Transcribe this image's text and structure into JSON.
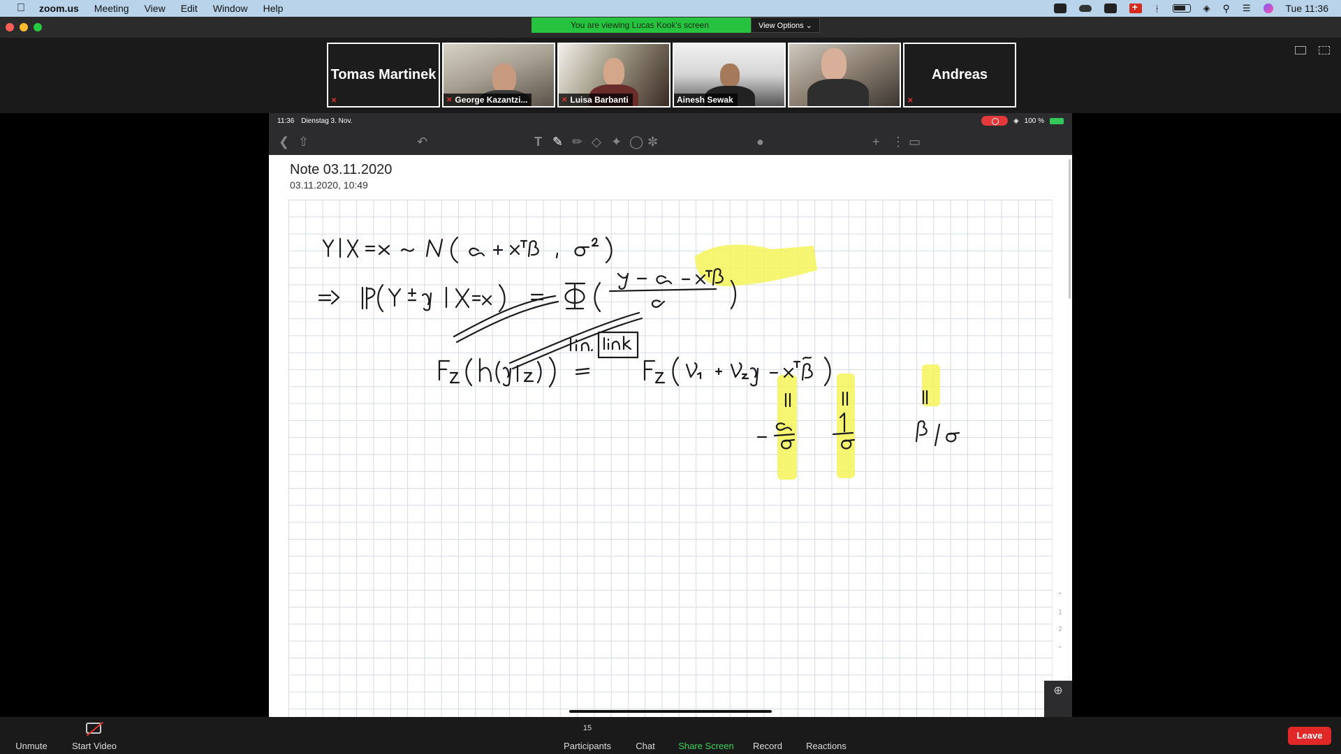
{
  "menubar": {
    "app_name": "zoom.us",
    "items": [
      "Meeting",
      "View",
      "Edit",
      "Window",
      "Help"
    ],
    "clock": "Tue 11:36"
  },
  "banner": {
    "message": "You are viewing Lucas Kook's screen",
    "options_label": "View Options"
  },
  "participants_strip": [
    {
      "name": "Tomas Martinek",
      "video": false,
      "muted": true
    },
    {
      "name": "George Kazantzi...",
      "video": true,
      "muted": true
    },
    {
      "name": "Luisa Barbanti",
      "video": true,
      "muted": true
    },
    {
      "name": "Ainesh Sewak",
      "video": true,
      "muted": false
    },
    {
      "name": "",
      "video": true,
      "muted": false
    },
    {
      "name": "Andreas",
      "video": false,
      "muted": true
    }
  ],
  "ipad": {
    "status_time": "11:36",
    "status_date": "Dienstag 3. Nov.",
    "battery": "100 %",
    "note_title": "Note 03.11.2020",
    "note_timestamp": "03.11.2020, 10:49",
    "page_numbers": [
      "1",
      "2"
    ]
  },
  "controls": {
    "unmute": "Unmute",
    "start_video": "Start Video",
    "participants": "Participants",
    "participant_count": "15",
    "chat": "Chat",
    "share_screen": "Share Screen",
    "record": "Record",
    "reactions": "Reactions",
    "leave": "Leave"
  },
  "colors": {
    "share_green": "#3ad15c",
    "leave_red": "#e02828",
    "banner_green": "#27c23f",
    "highlighter": "#f4f55a"
  }
}
